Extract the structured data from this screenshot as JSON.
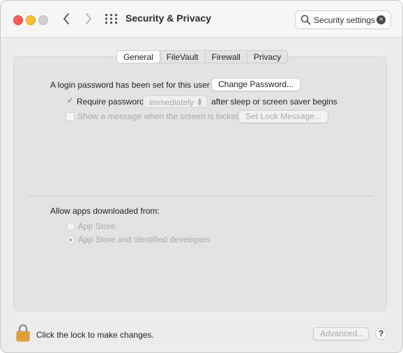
{
  "window": {
    "title": "Security & Privacy",
    "search_value": "Security settings"
  },
  "tabs": [
    {
      "label": "General",
      "active": true
    },
    {
      "label": "FileVault",
      "active": false
    },
    {
      "label": "Firewall",
      "active": false
    },
    {
      "label": "Privacy",
      "active": false
    }
  ],
  "general": {
    "login_text": "A login password has been set for this user",
    "change_password_label": "Change Password...",
    "require_password_label": "Require password",
    "require_password_checked": true,
    "require_password_delay": "immediately",
    "after_sleep_text": "after sleep or screen saver begins",
    "show_message_label": "Show a message when the screen is locked",
    "show_message_checked": false,
    "set_lock_message_label": "Set Lock Message..."
  },
  "downloads": {
    "heading": "Allow apps downloaded from:",
    "options": [
      {
        "label": "App Store",
        "selected": false
      },
      {
        "label": "App Store and identified developers",
        "selected": true
      }
    ]
  },
  "footer": {
    "lock_text": "Click the lock to make changes.",
    "advanced_label": "Advanced...",
    "help_label": "?"
  },
  "colors": {
    "close": "#fe5f57",
    "minimize": "#febc2e",
    "zoom_inactive": "#d0d0d0",
    "lock": "#e7a33c"
  },
  "icons": {
    "back": "chevron-left-icon",
    "forward": "chevron-right-icon",
    "grid": "grid-icon",
    "search": "search-icon",
    "clear": "clear-icon",
    "lock": "lock-icon"
  }
}
